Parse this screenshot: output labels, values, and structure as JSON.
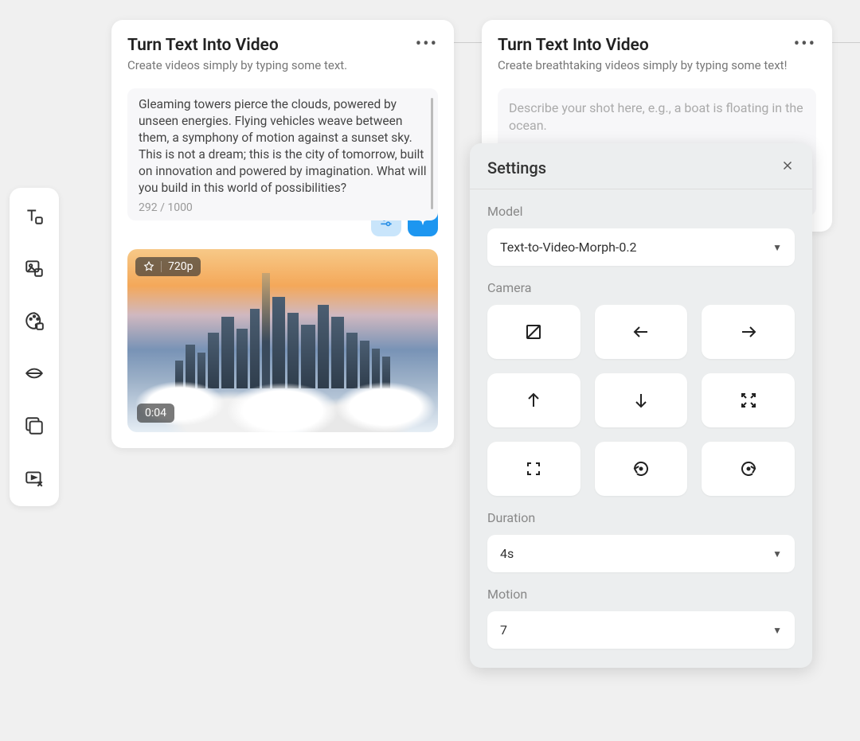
{
  "sidebar": {
    "items": [
      "text-tool",
      "image-tool",
      "palette-tool",
      "lips-tool",
      "layers-tool",
      "video-cut-tool"
    ]
  },
  "card_left": {
    "title": "Turn Text Into Video",
    "subtitle": "Create videos simply by typing some text.",
    "prompt": "Gleaming towers pierce the clouds, powered by unseen energies. Flying vehicles weave between them, a symphony of motion against a sunset sky. This is not a dream; this is the city of tomorrow, built on innovation and powered by imagination. What will you build in this world of possibilities?",
    "char_count": "292 / 1000",
    "resolution": "720p",
    "duration": "0:04"
  },
  "card_right": {
    "title": "Turn Text Into Video",
    "subtitle": "Create breathtaking videos simply by typing some text!",
    "placeholder": "Describe your shot here, e.g., a boat is floating in the ocean."
  },
  "settings": {
    "title": "Settings",
    "model_label": "Model",
    "model_value": "Text-to-Video-Morph-0.2",
    "camera_label": "Camera",
    "camera_options": [
      "none",
      "left",
      "right",
      "up",
      "down",
      "zoom-in",
      "zoom-out",
      "rotate-ccw",
      "rotate-cw"
    ],
    "duration_label": "Duration",
    "duration_value": "4s",
    "motion_label": "Motion",
    "motion_value": "7"
  }
}
